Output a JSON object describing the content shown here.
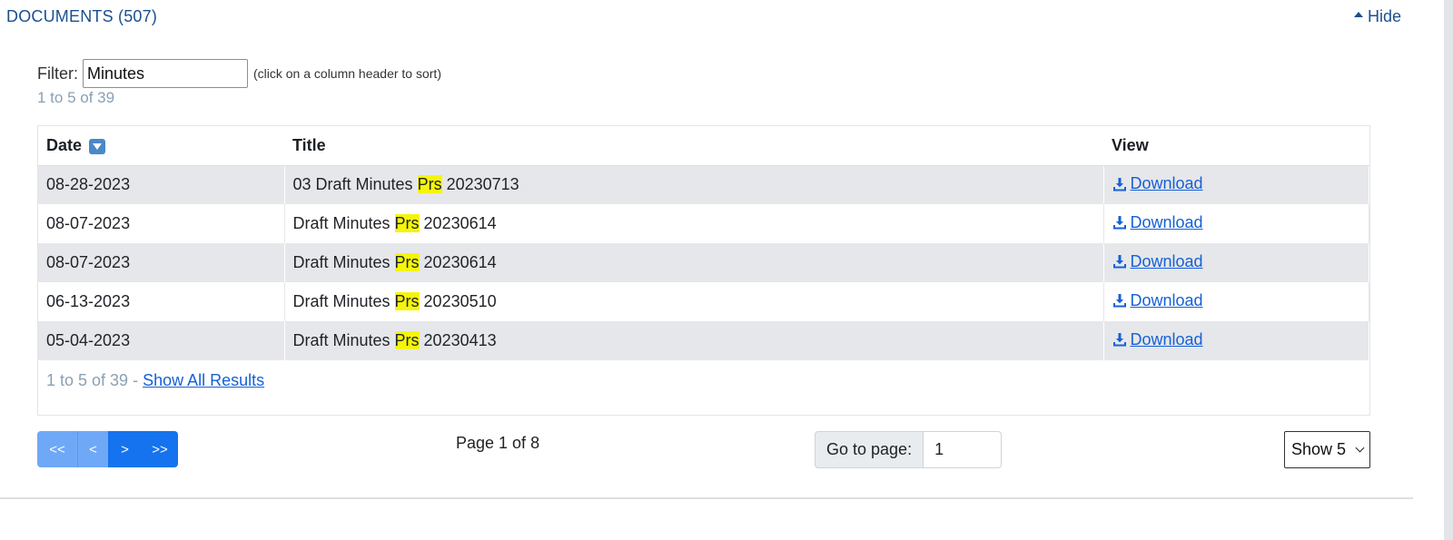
{
  "section": {
    "title": "DOCUMENTS (507)",
    "hide_label": "Hide"
  },
  "filter": {
    "label": "Filter:",
    "value": "Minutes",
    "hint": "(click on a column header to sort)"
  },
  "count_top": "1 to 5 of 39",
  "table": {
    "headers": {
      "date": "Date",
      "title": "Title",
      "view": "View"
    },
    "rows": [
      {
        "date": "08-28-2023",
        "title_before": "03 Draft Minutes ",
        "title_highlight": "Prs",
        "title_after": " 20230713",
        "view": "Download"
      },
      {
        "date": "08-07-2023",
        "title_before": "Draft Minutes ",
        "title_highlight": "Prs",
        "title_after": " 20230614",
        "view": "Download"
      },
      {
        "date": "08-07-2023",
        "title_before": "Draft Minutes ",
        "title_highlight": "Prs",
        "title_after": " 20230614",
        "view": "Download"
      },
      {
        "date": "06-13-2023",
        "title_before": "Draft Minutes ",
        "title_highlight": "Prs",
        "title_after": " 20230510",
        "view": "Download"
      },
      {
        "date": "05-04-2023",
        "title_before": "Draft Minutes ",
        "title_highlight": "Prs",
        "title_after": " 20230413",
        "view": "Download"
      }
    ],
    "footer_count": "1 to 5 of 39 - ",
    "show_all": "Show All Results"
  },
  "pager": {
    "first": "<<",
    "prev": "<",
    "next": ">",
    "last": ">>"
  },
  "page_indicator": "Page 1 of 8",
  "goto": {
    "label": "Go to page:",
    "value": "1"
  },
  "show": {
    "selected": "Show 5"
  },
  "colors": {
    "link": "#1561d6",
    "brand": "#1b4f8f",
    "highlight": "#f5f50a",
    "row_alt": "#e6e7ea",
    "pager_active": "#1673ef",
    "pager_disabled": "#6fa8f7"
  },
  "icons": {
    "sort": "sort-desc-icon",
    "download": "download-icon",
    "hide": "caret-up-icon"
  }
}
